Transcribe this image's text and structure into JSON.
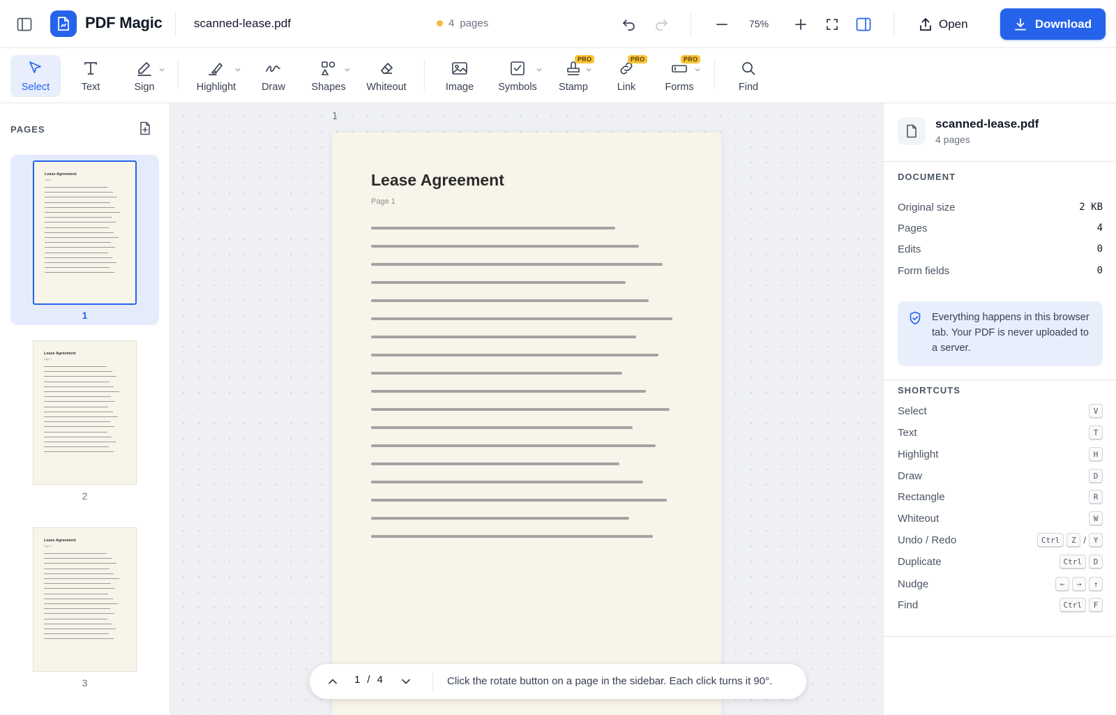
{
  "header": {
    "app_name": "PDF Magic",
    "file_name": "scanned-lease.pdf",
    "page_count": "4",
    "page_count_unit": "pages",
    "zoom": "75%",
    "open_label": "Open",
    "download_label": "Download",
    "status_dot_color": "#f5b942"
  },
  "toolbar": {
    "select": "Select",
    "text": "Text",
    "sign": "Sign",
    "highlight": "Highlight",
    "draw": "Draw",
    "shapes": "Shapes",
    "whiteout": "Whiteout",
    "image": "Image",
    "symbols": "Symbols",
    "stamp": "Stamp",
    "link": "Link",
    "forms": "Forms",
    "find": "Find",
    "pro_badge": "PRO"
  },
  "sidebar": {
    "title": "PAGES",
    "thumbnails": [
      {
        "number": "1",
        "title": "Lease Agreement",
        "sub": "Page 1",
        "selected": true
      },
      {
        "number": "2",
        "title": "Lease Agreement",
        "sub": "Page 2",
        "selected": false
      },
      {
        "number": "3",
        "title": "Lease Agreement",
        "sub": "Page 3",
        "selected": false
      }
    ]
  },
  "canvas": {
    "page_label": "1",
    "page_title": "Lease Agreement",
    "page_subtitle": "Page 1"
  },
  "nav": {
    "current_page": "1",
    "separator": "/",
    "total_pages": "4",
    "message": "Click the rotate button on a page in the sidebar. Each click turns it 90°."
  },
  "panel": {
    "file_name": "scanned-lease.pdf",
    "file_pages": "4 pages",
    "document_heading": "DOCUMENT",
    "stats": [
      {
        "label": "Original size",
        "value": "2 KB"
      },
      {
        "label": "Pages",
        "value": "4"
      },
      {
        "label": "Edits",
        "value": "0"
      },
      {
        "label": "Form fields",
        "value": "0"
      }
    ],
    "privacy_note": "Everything happens in this browser tab. Your PDF is never uploaded to a server.",
    "shortcuts_heading": "SHORTCUTS",
    "shortcuts": [
      {
        "label": "Select",
        "keys": [
          "V"
        ]
      },
      {
        "label": "Text",
        "keys": [
          "T"
        ]
      },
      {
        "label": "Highlight",
        "keys": [
          "H"
        ]
      },
      {
        "label": "Draw",
        "keys": [
          "D"
        ]
      },
      {
        "label": "Rectangle",
        "keys": [
          "R"
        ]
      },
      {
        "label": "Whiteout",
        "keys": [
          "W"
        ]
      },
      {
        "label": "Undo / Redo",
        "keys": [
          "Ctrl",
          "Z",
          "/",
          "Y"
        ]
      },
      {
        "label": "Duplicate",
        "keys": [
          "Ctrl",
          "D"
        ]
      },
      {
        "label": "Nudge",
        "keys": [
          "←",
          "→",
          "↑"
        ]
      },
      {
        "label": "Find",
        "keys": [
          "Ctrl",
          "F"
        ]
      }
    ]
  },
  "colors": {
    "accent": "#2563eb",
    "pro_badge": "#f8c33a",
    "page_paper": "#f7f4ea"
  }
}
